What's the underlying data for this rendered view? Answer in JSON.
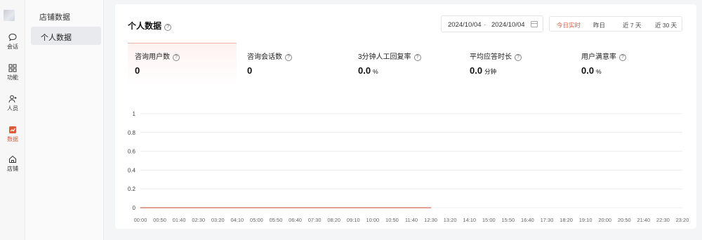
{
  "rail": [
    {
      "label": "会话",
      "icon": "chat-bubble-icon",
      "active": false
    },
    {
      "label": "功能",
      "icon": "grid-apps-icon",
      "active": false
    },
    {
      "label": "人员",
      "icon": "user-add-icon",
      "active": false
    },
    {
      "label": "数据",
      "icon": "data-chart-icon",
      "active": true
    },
    {
      "label": "店铺",
      "icon": "home-icon",
      "active": false
    }
  ],
  "subnav": {
    "group_title": "店铺数据",
    "active_item": "个人数据"
  },
  "page": {
    "title": "个人数据"
  },
  "date_range": {
    "start": "2024/10/04",
    "separator": "-",
    "end": "2024/10/04"
  },
  "quick_ranges": [
    "今日实时",
    "昨日",
    "近 7 天",
    "近 30 天"
  ],
  "metrics": [
    {
      "label": "咨询用户数",
      "value": "0",
      "unit": ""
    },
    {
      "label": "咨询会话数",
      "value": "0",
      "unit": ""
    },
    {
      "label": "3分钟人工回复率",
      "value": "0.0",
      "unit": "%"
    },
    {
      "label": "平均应答时长",
      "value": "0.0",
      "unit": "分钟"
    },
    {
      "label": "用户满意率",
      "value": "0.0",
      "unit": "%"
    }
  ],
  "colors": {
    "accent": "#e05a3a",
    "line": "#d9846c"
  },
  "chart_data": {
    "type": "line",
    "title": "",
    "xlabel": "",
    "ylabel": "",
    "ylim": [
      0,
      1
    ],
    "yticks": [
      "0",
      "0.2",
      "0.4",
      "0.6",
      "0.8",
      "1"
    ],
    "categories": [
      "00:00",
      "00:50",
      "01:40",
      "02:30",
      "03:20",
      "04:10",
      "05:00",
      "05:50",
      "06:40",
      "07:30",
      "08:20",
      "09:10",
      "10:00",
      "10:50",
      "11:40",
      "12:30",
      "13:20",
      "14:10",
      "15:00",
      "15:50",
      "16:40",
      "17:30",
      "18:20",
      "19:10",
      "20:00",
      "20:50",
      "21:40",
      "22:30",
      "23:20"
    ],
    "series": [
      {
        "values": [
          0,
          0,
          0,
          0,
          0,
          0,
          0,
          0,
          0,
          0,
          0,
          0,
          0,
          0,
          0,
          0
        ]
      }
    ],
    "grid": true
  }
}
